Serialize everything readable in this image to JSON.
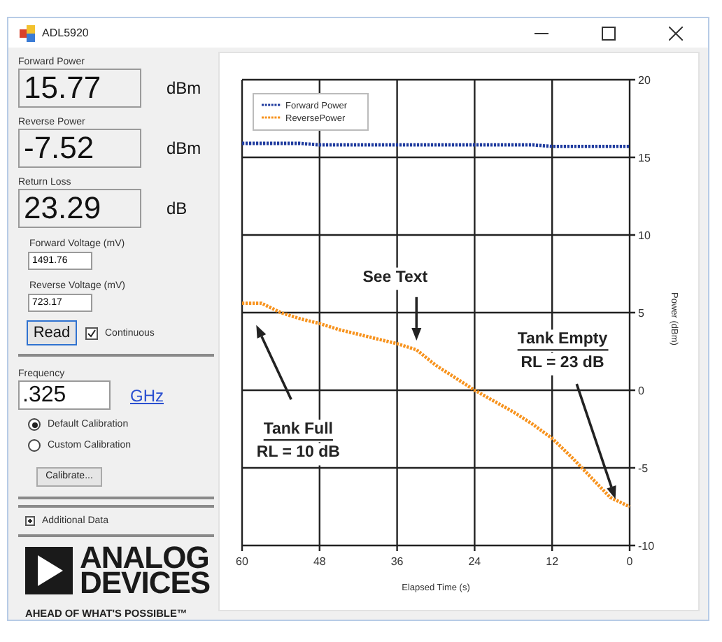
{
  "window": {
    "title": "ADL5920"
  },
  "readings": [
    {
      "kind": "large",
      "label": "Forward Power",
      "value": "15.77",
      "unit": "dBm"
    },
    {
      "kind": "large",
      "label": "Reverse Power",
      "value": "-7.52",
      "unit": "dBm"
    },
    {
      "kind": "large",
      "label": "Return Loss",
      "value": "23.29",
      "unit": "dB"
    },
    {
      "kind": "small",
      "label": "Forward Voltage (mV)",
      "value": "1491.76"
    },
    {
      "kind": "small",
      "label": "Reverse Voltage (mV)",
      "value": "723.17"
    }
  ],
  "read_button": "Read",
  "continuous": {
    "label": "Continuous",
    "checked": true
  },
  "frequency": {
    "label": "Frequency",
    "value": ".325",
    "unit_link": "GHz"
  },
  "calibration": [
    {
      "label": "Default Calibration",
      "selected": true
    },
    {
      "label": "Custom Calibration",
      "selected": false
    }
  ],
  "calibrate_button": "Calibrate...",
  "additional_data": {
    "label": "Additional Data",
    "expanded": false
  },
  "logo": {
    "lines": [
      "ANALOG",
      "DEVICES"
    ],
    "tagline": "AHEAD OF WHAT'S POSSIBLE™"
  },
  "chart": {
    "chart_data": {
      "type": "line",
      "xlabel": "Elapsed Time (s)",
      "ylabel": "Power (dBm)",
      "x": [
        60,
        57,
        54,
        51,
        48,
        45,
        42,
        39,
        36,
        33,
        30,
        27,
        24,
        21,
        18,
        15,
        12,
        9,
        6,
        3,
        0
      ],
      "series": [
        {
          "name": "Forward Power",
          "color": "#1f3b9e",
          "line_style": "dotted",
          "values": [
            15.9,
            15.9,
            15.9,
            15.9,
            15.8,
            15.8,
            15.8,
            15.8,
            15.8,
            15.8,
            15.8,
            15.8,
            15.8,
            15.8,
            15.8,
            15.8,
            15.7,
            15.7,
            15.7,
            15.7,
            15.7
          ]
        },
        {
          "name": "ReversePower",
          "color": "#f7931e",
          "line_style": "dotted",
          "values": [
            5.6,
            5.6,
            5.0,
            4.6,
            4.3,
            3.9,
            3.6,
            3.3,
            3.0,
            2.6,
            1.6,
            0.8,
            0.0,
            -0.7,
            -1.4,
            -2.2,
            -3.1,
            -4.3,
            -5.6,
            -6.9,
            -7.5
          ]
        }
      ],
      "xlim": [
        60,
        0
      ],
      "ylim": [
        -10,
        20
      ],
      "xticks": [
        60,
        48,
        36,
        24,
        12,
        0
      ],
      "yticks": [
        -10,
        -5,
        0,
        5,
        10,
        15,
        20
      ],
      "grid": true,
      "legend": true,
      "annotations": [
        "See Text",
        "Tank Full",
        "RL = 10 dB",
        "Tank Empty",
        "RL = 23 dB"
      ]
    }
  }
}
